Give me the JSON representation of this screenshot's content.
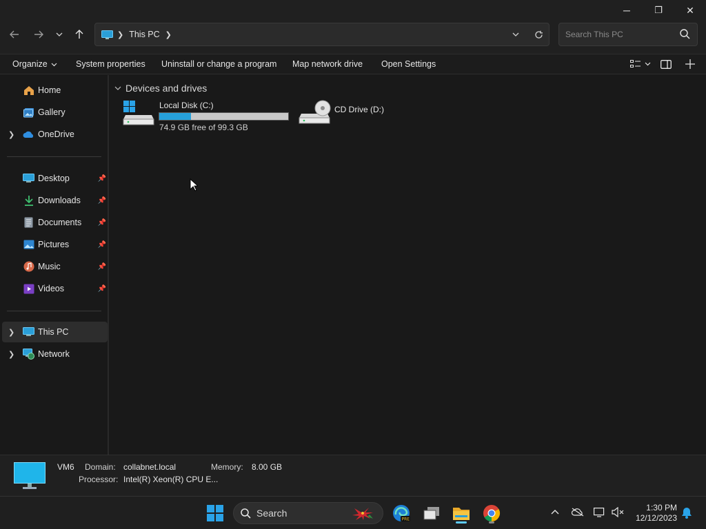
{
  "window": {
    "minimize_glyph": "─",
    "maximize_glyph": "❐",
    "close_glyph": "✕"
  },
  "address": {
    "breadcrumb": [
      "This PC"
    ],
    "search_placeholder": "Search This PC"
  },
  "commands": {
    "organize": "Organize",
    "system_properties": "System properties",
    "uninstall": "Uninstall or change a program",
    "map_drive": "Map network drive",
    "open_settings": "Open Settings"
  },
  "sidebar": {
    "quick": [
      {
        "label": "Home",
        "icon": "home-icon",
        "expandable": false
      },
      {
        "label": "Gallery",
        "icon": "gallery-icon",
        "expandable": false
      },
      {
        "label": "OneDrive",
        "icon": "onedrive-icon",
        "expandable": true
      }
    ],
    "pinned": [
      {
        "label": "Desktop",
        "icon": "desktop-icon"
      },
      {
        "label": "Downloads",
        "icon": "downloads-icon"
      },
      {
        "label": "Documents",
        "icon": "documents-icon"
      },
      {
        "label": "Pictures",
        "icon": "pictures-icon"
      },
      {
        "label": "Music",
        "icon": "music-icon"
      },
      {
        "label": "Videos",
        "icon": "videos-icon"
      }
    ],
    "locations": [
      {
        "label": "This PC",
        "icon": "this-pc-icon",
        "selected": true
      },
      {
        "label": "Network",
        "icon": "network-icon",
        "selected": false
      }
    ]
  },
  "content": {
    "group_title": "Devices and drives",
    "drives": [
      {
        "name": "Local Disk (C:)",
        "free_text": "74.9 GB free of 99.3 GB",
        "used_fraction": 0.246
      },
      {
        "name": "CD Drive (D:)"
      }
    ]
  },
  "details": {
    "computer_name": "VM6",
    "domain_label": "Domain:",
    "domain_value": "collabnet.local",
    "memory_label": "Memory:",
    "memory_value": "8.00 GB",
    "processor_label": "Processor:",
    "processor_value": "Intel(R) Xeon(R) CPU E..."
  },
  "taskbar": {
    "search_label": "Search",
    "time": "1:30 PM",
    "date": "12/12/2023",
    "accent": "#60cdff"
  }
}
